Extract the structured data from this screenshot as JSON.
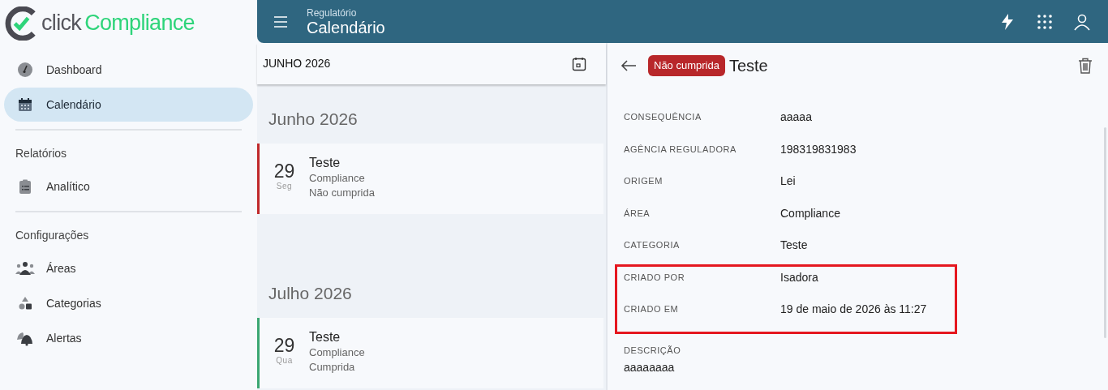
{
  "logo": {
    "word_1": "click",
    "word_2": "Compliance"
  },
  "sidebar": {
    "sections": [
      {
        "items": [
          {
            "label": "Dashboard",
            "selected": false
          },
          {
            "label": "Calendário",
            "selected": true
          }
        ]
      },
      {
        "heading": "Relatórios",
        "items": [
          {
            "label": "Analítico",
            "selected": false
          }
        ]
      },
      {
        "heading": "Configurações",
        "items": [
          {
            "label": "Áreas",
            "selected": false
          },
          {
            "label": "Categorias",
            "selected": false
          },
          {
            "label": "Alertas",
            "selected": false
          }
        ]
      }
    ]
  },
  "header": {
    "subtitle": "Regulatório",
    "title": "Calendário"
  },
  "list": {
    "month_label": "JUNHO 2026",
    "groups": [
      {
        "title": "Junho 2026",
        "events": [
          {
            "day": "29",
            "weekday": "Seg",
            "title": "Teste",
            "area": "Compliance",
            "status": "Não cumprida",
            "color": "#c0292b"
          }
        ]
      },
      {
        "title": "Julho 2026",
        "events": [
          {
            "day": "29",
            "weekday": "Qua",
            "title": "Teste",
            "area": "Compliance",
            "status": "Cumprida",
            "color": "#3aa672"
          }
        ]
      }
    ]
  },
  "detail": {
    "status_badge": "Não cumprida",
    "title": "Teste",
    "fields": [
      {
        "label": "CONSEQUÊNCIA",
        "value": "aaaaa",
        "highlighted": false
      },
      {
        "label": "AGÊNCIA REGULADORA",
        "value": "198319831983",
        "highlighted": false
      },
      {
        "label": "ORIGEM",
        "value": "Lei",
        "highlighted": false
      },
      {
        "label": "ÁREA",
        "value": "Compliance",
        "highlighted": false
      },
      {
        "label": "CATEGORIA",
        "value": "Teste",
        "highlighted": false
      },
      {
        "label": "CRIADO POR",
        "value": "Isadora",
        "highlighted": true
      },
      {
        "label": "CRIADO EM",
        "value": "19 de maio de 2026 às 11:27",
        "highlighted": true
      }
    ],
    "description": {
      "label": "DESCRIÇÃO",
      "value": "aaaaaaaa"
    }
  }
}
